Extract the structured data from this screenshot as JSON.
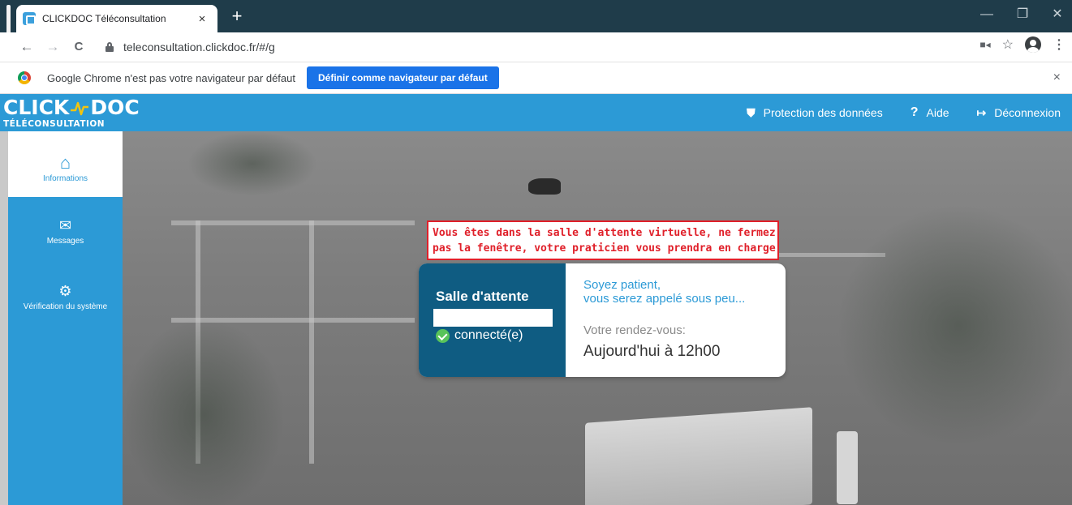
{
  "browser": {
    "tab_title": "CLICKDOC Téléconsultation",
    "tab_close": "×",
    "new_tab": "+",
    "window_controls": {
      "minimize": "—",
      "restore": "❐",
      "close": "✕"
    },
    "nav": {
      "back": "←",
      "forward": "→",
      "reload": "C"
    },
    "url": "teleconsultation.clickdoc.fr/#/g",
    "infobar": {
      "message": "Google Chrome n'est pas votre navigateur par défaut",
      "button_label": "Définir comme navigateur par défaut",
      "close": "×"
    }
  },
  "header": {
    "brand_left": "CLICK",
    "brand_right": "DOC",
    "brand_sub": "TÉLÉCONSULTATION",
    "links": [
      {
        "label": "Protection des données",
        "icon": "shield-icon",
        "glyph": "⛊"
      },
      {
        "label": "Aide",
        "icon": "question-icon",
        "glyph": "?"
      },
      {
        "label": "Déconnexion",
        "icon": "logout-icon",
        "glyph": "↦"
      }
    ]
  },
  "sidebar": {
    "items": [
      {
        "label": "Informations",
        "icon": "home-icon",
        "glyph": "⌂",
        "active": true
      },
      {
        "label": "Messages",
        "icon": "envelope-icon",
        "glyph": "✉",
        "active": false
      },
      {
        "label": "Vérification du système",
        "icon": "gear-icon",
        "glyph": "⚙",
        "active": false
      }
    ]
  },
  "notice": {
    "line1": "Vous êtes dans la salle d'attente virtuelle, ne fermez",
    "line2": "pas la fenêtre, votre praticien vous prendra en charge"
  },
  "waiting_card": {
    "title": "Salle d'attente",
    "status": "connecté(e)",
    "message_line1": "Soyez patient,",
    "message_line2": "vous serez appelé sous peu...",
    "appointment_label": "Votre rendez-vous:",
    "appointment_value": "Aujourd'hui à 12h00"
  },
  "colors": {
    "brand_blue": "#2c9ad6",
    "card_dark": "#0f5c82",
    "notice_red": "#e0202a",
    "status_green": "#58c35a"
  }
}
